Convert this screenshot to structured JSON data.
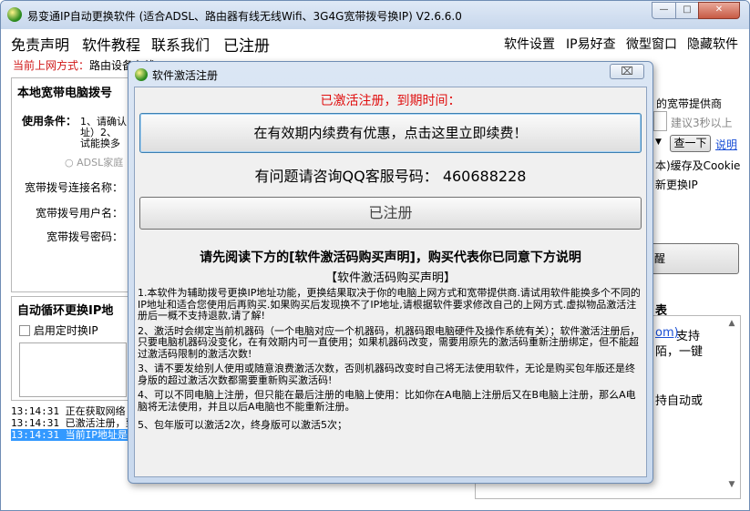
{
  "window": {
    "title": "易变通IP自动更换软件 (适合ADSL、路由器有线无线Wifi、3G4G宽带拨号换IP) V2.6.6.0",
    "min_label": "—",
    "max_label": "□",
    "close_label": "✕"
  },
  "menu": {
    "disclaimer": "免责声明",
    "tutorial": "软件教程",
    "contact": "联系我们",
    "registered": "已注册",
    "settings": "软件设置",
    "ip_check": "IP易好查",
    "mini_window": "微型窗口",
    "hide": "隐藏软件"
  },
  "info": {
    "label": "当前上网方式：",
    "value": "路由设备有线"
  },
  "left_panel": {
    "title": "本地宽带电脑拨号",
    "usage_label": "使用条件：",
    "usage_text_1": "1、请确认",
    "usage_text_2": "址）2、",
    "usage_text_3": "试能换多",
    "radio_adsl": "ADSL家庭",
    "conn_name": "宽带拨号连接名称：",
    "user_name": "宽带拨号用户名：",
    "password": "宽带拨号密码："
  },
  "loop_panel": {
    "title": "自动循环更换IP地",
    "timer_label": "启用定时换IP"
  },
  "right_panel": {
    "provider": "的宽带提供商",
    "suggest": "建议3秒以上",
    "find_next": "查一下",
    "help": "说明",
    "cache": "本)缓存及Cookie",
    "renew_ip": "新更换IP",
    "wake": "醒",
    "table_tab": "表",
    "support_link": "om)",
    "support": "支持",
    "text_a": "陌，一键",
    "text_b": "持自动或"
  },
  "log": [
    {
      "time": "13:14:31",
      "text": "正在获取网络"
    },
    {
      "time": "13:14:31",
      "text": "已激活注册，到"
    },
    {
      "time": "13:14:31",
      "text": "当前IP地址是"
    }
  ],
  "dialog": {
    "title": "软件激活注册",
    "close_label": "⌧",
    "status": "已激活注册，到期时间：",
    "renew_button": "在有效期内续费有优惠，点击这里立即续费！",
    "qq_line": "有问题请咨询QQ客服号码：  460688228",
    "registered_button": "已注册",
    "notice": "请先阅读下方的[软件激活码购买声明]，购买代表你已同意下方说明",
    "subtitle": "【软件激活码购买声明】",
    "terms": [
      "1.本软件为辅助拨号更换IP地址功能，更换结果取决于你的电脑上网方式和宽带提供商.请试用软件能换多个不同的IP地址和适合您使用后再购买.如果购买后发现换不了IP地址,请根据软件要求修改自己的上网方式.虚拟物品激活注册后一概不支持退款,请了解!",
      "2、激活时会绑定当前机器码（一个电脑对应一个机器码，机器码跟电脑硬件及操作系统有关）；软件激活注册后，只要电脑机器码没变化，在有效期内可一直使用；如果机器码改变，需要用原先的激活码重新注册绑定，但不能超过激活码限制的激活次数!",
      "3、请不要发给别人使用或随意浪费激活次数，否则机器码改变时自己将无法使用软件，无论是购买包年版还是终身版的超过激活次数都需要重新购买激活码!",
      "4、可以不同电脑上注册，但只能在最后注册的电脑上使用：比如你在A电脑上注册后又在B电脑上注册，那么A电脑将无法使用，并且以后A电脑也不能重新注册。",
      "5、包年版可以激活2次，终身版可以激活5次；"
    ]
  }
}
